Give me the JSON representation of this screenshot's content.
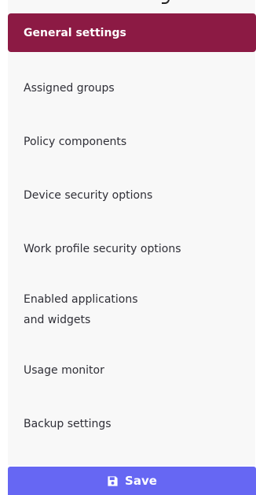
{
  "menu": {
    "items": [
      {
        "label": "General settings",
        "active": true
      },
      {
        "label": "Assigned groups"
      },
      {
        "label": "Policy components"
      },
      {
        "label": "Device security options"
      },
      {
        "label": "Work profile security options"
      },
      {
        "label": "Enabled applications\nand widgets"
      },
      {
        "label": "Usage monitor"
      },
      {
        "label": "Backup settings"
      }
    ]
  },
  "footer": {
    "save_label": "Save",
    "save_icon": "floppy-disk-icon"
  },
  "colors": {
    "active_item_bg": "#8c1a44",
    "save_button_bg": "#6667f3",
    "panel_bg": "#f8f8f8",
    "text": "#2f2f37"
  }
}
